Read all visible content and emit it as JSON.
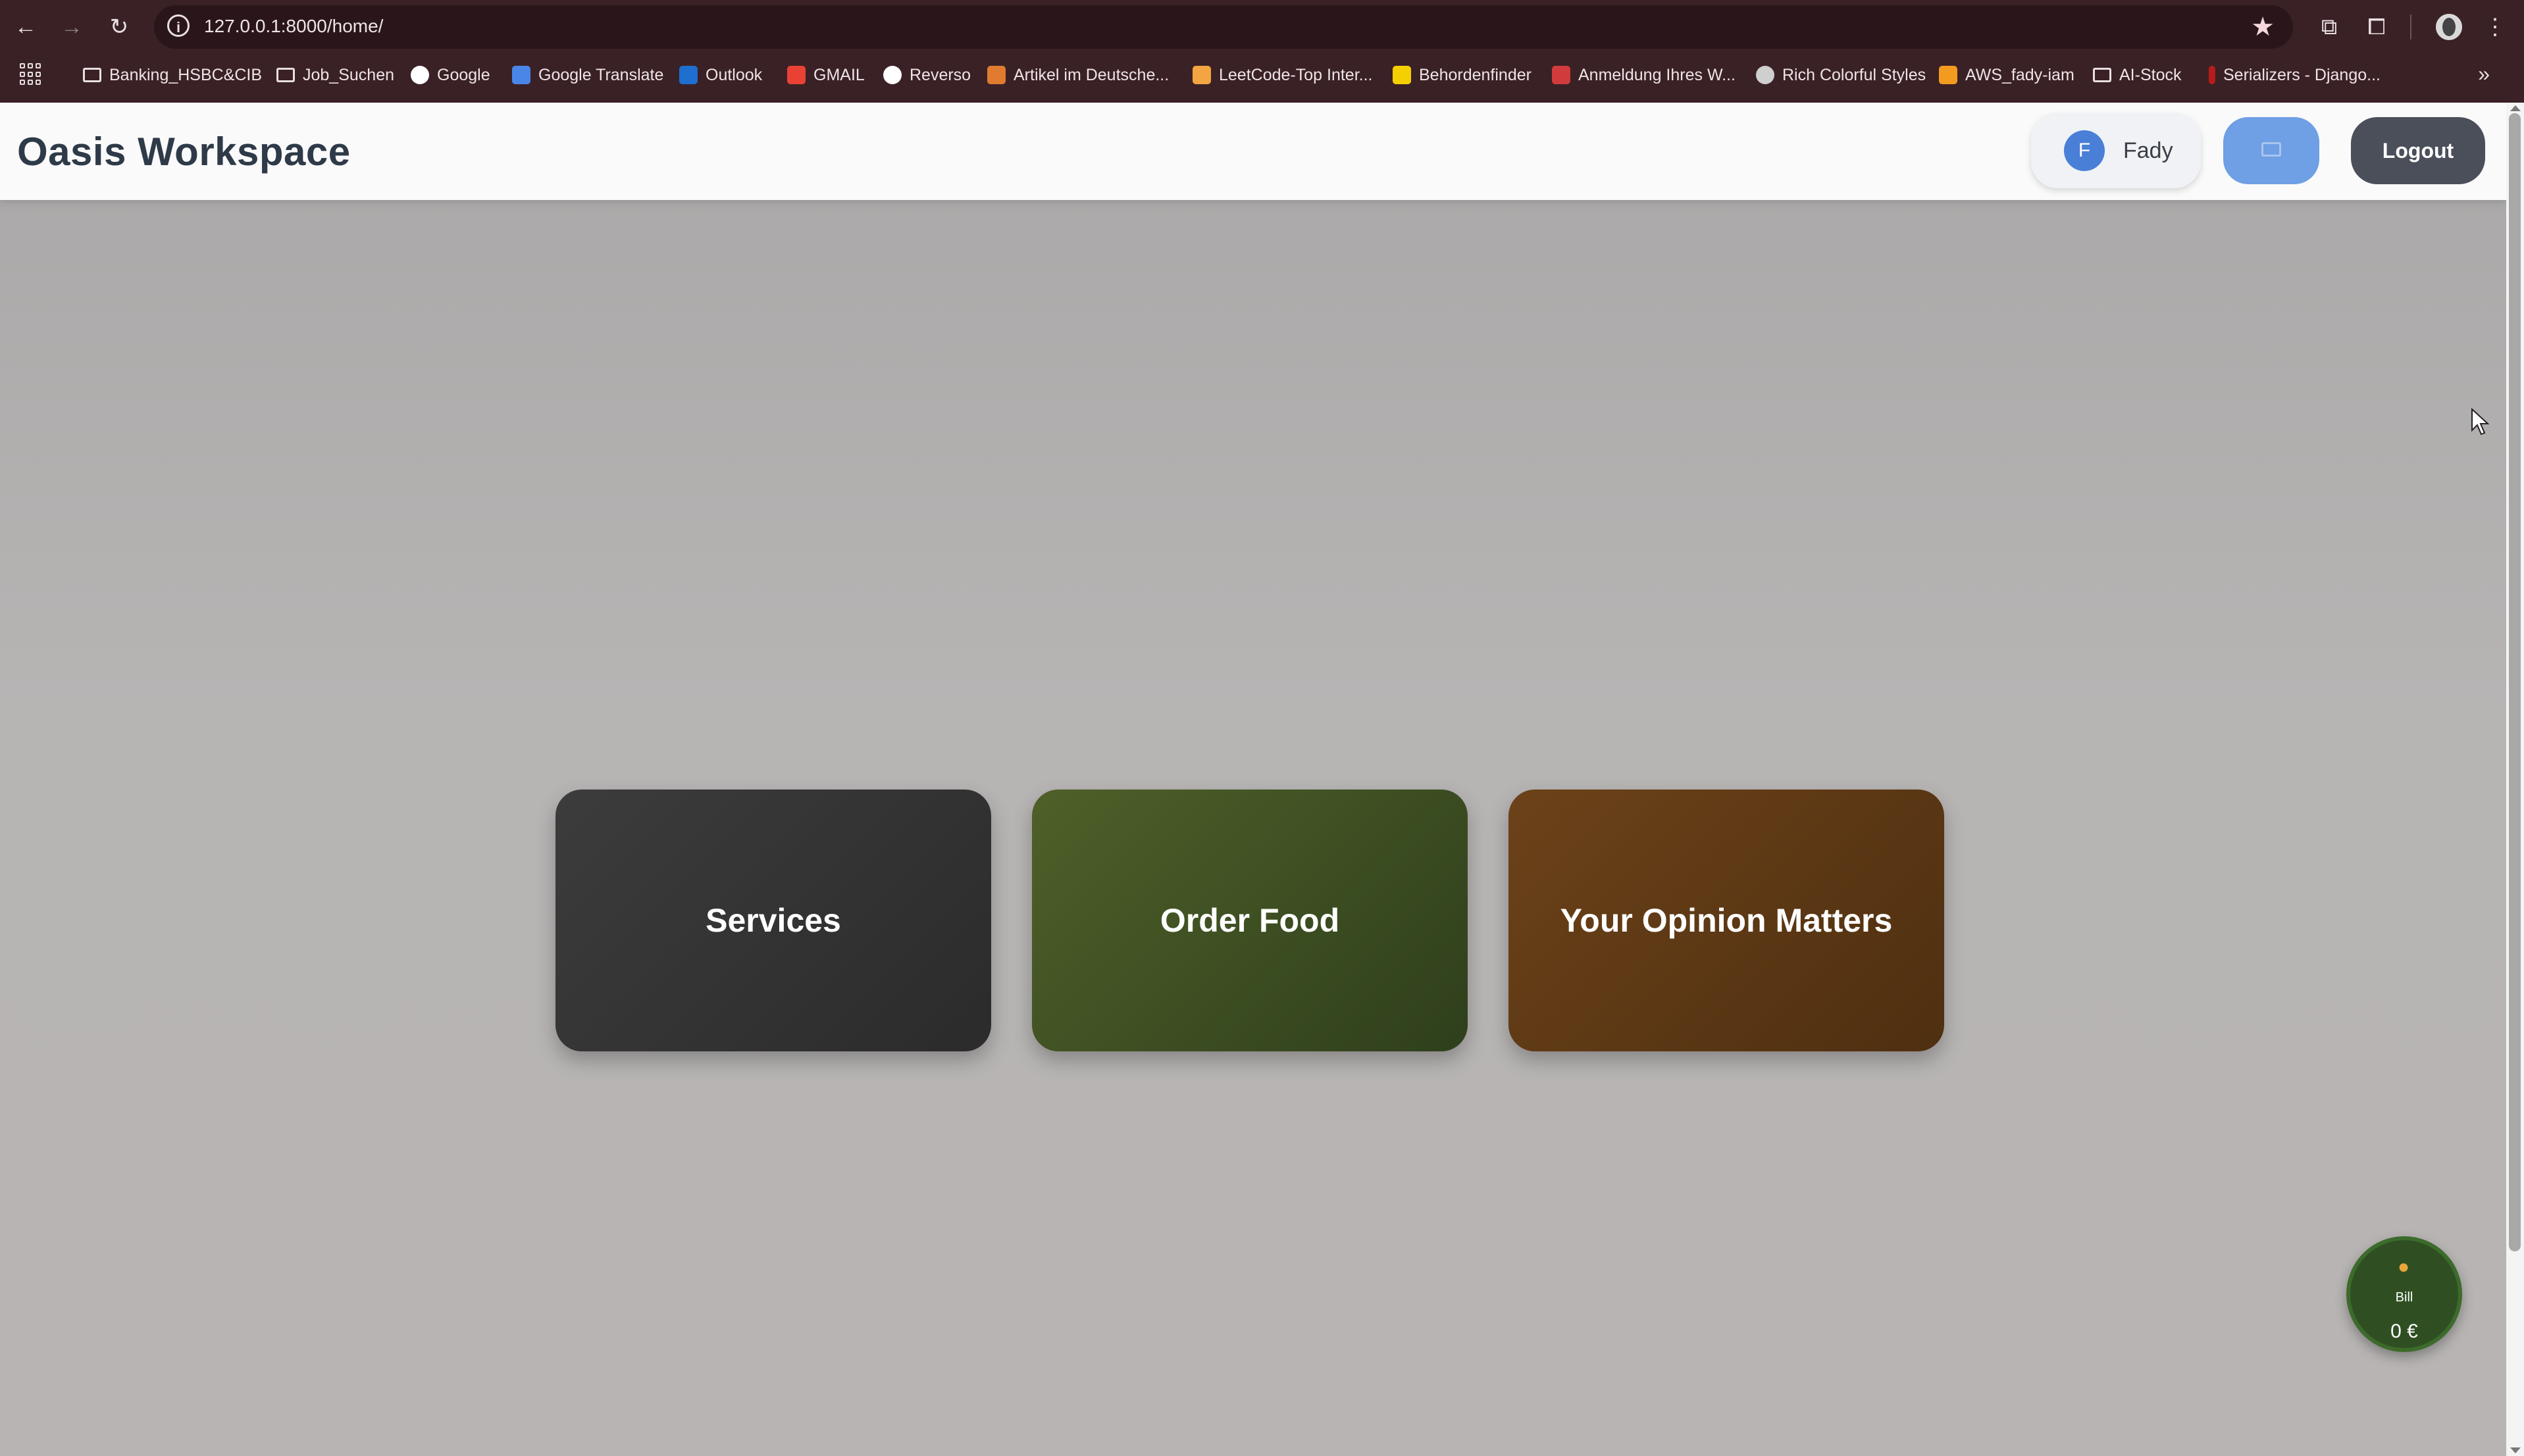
{
  "browser": {
    "url": "127.0.0.1:8000/home/",
    "bookmarks": [
      {
        "label": "Banking_HSBC&CIB",
        "type": "folder"
      },
      {
        "label": "Job_Suchen",
        "type": "folder"
      },
      {
        "label": "Google",
        "type": "site",
        "color": "#ffffff"
      },
      {
        "label": "Google Translate",
        "type": "site",
        "color": "#4a86e8"
      },
      {
        "label": "Outlook",
        "type": "site",
        "color": "#1e6fd0"
      },
      {
        "label": "GMAIL",
        "type": "site",
        "color": "#e94235"
      },
      {
        "label": "Reverso",
        "type": "site",
        "color": "#ffffff"
      },
      {
        "label": "Artikel im Deutsche...",
        "type": "site",
        "color": "#e07b2f"
      },
      {
        "label": "LeetCode-Top Inter...",
        "type": "site",
        "color": "#f2a541"
      },
      {
        "label": "Behordenfinder",
        "type": "site",
        "color": "#f5d000"
      },
      {
        "label": "Anmeldung Ihres W...",
        "type": "site",
        "color": "#d23b3b"
      },
      {
        "label": "Rich Colorful Styles",
        "type": "site",
        "color": "#cfcfcf"
      },
      {
        "label": "AWS_fady-iam",
        "type": "site",
        "color": "#f29b20"
      },
      {
        "label": "AI-Stock",
        "type": "folder"
      },
      {
        "label": "Serializers - Django...",
        "type": "site",
        "color": "#b71c1c"
      }
    ]
  },
  "header": {
    "brand": "Oasis Workspace",
    "user": {
      "initial": "F",
      "name": "Fady"
    },
    "logout_label": "Logout"
  },
  "tiles": [
    {
      "label": "Services",
      "color": "#333333"
    },
    {
      "label": "Order Food",
      "color": "#45552a"
    },
    {
      "label": "Your Opinion Matters",
      "color": "#5f3a16"
    }
  ],
  "bill": {
    "icon": "money-bag-icon",
    "label": "Bill",
    "amount": "0 €"
  }
}
